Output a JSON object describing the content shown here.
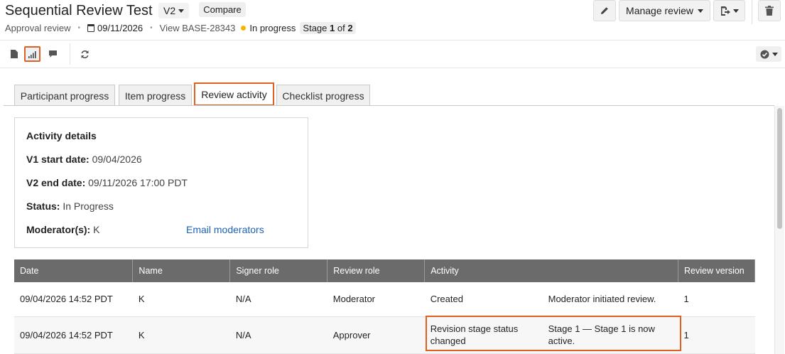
{
  "header": {
    "title": "Sequential Review Test",
    "version": "V2",
    "compare_label": "Compare",
    "review_type": "Approval review",
    "date": "09/11/2026",
    "view_id": "View BASE-28343",
    "status": "In progress",
    "stage_prefix": "Stage",
    "stage_current": "1",
    "stage_of": "of",
    "stage_total": "2",
    "manage_label": "Manage review",
    "status_color": "#f5b400"
  },
  "tabs": [
    "Participant progress",
    "Item progress",
    "Review activity",
    "Checklist progress"
  ],
  "details": {
    "title": "Activity details",
    "v1_label": "V1 start date:",
    "v1_value": "09/04/2026",
    "v2_label": "V2 end date:",
    "v2_value": "09/11/2026 17:00 PDT",
    "status_label": "Status:",
    "status_value": "In Progress",
    "moderators_label": "Moderator(s):",
    "moderators_value": "K",
    "email_label": "Email moderators"
  },
  "table": {
    "columns": [
      "Date",
      "Name",
      "Signer role",
      "Review role",
      "Activity",
      "",
      "Review version"
    ],
    "rows": [
      {
        "date": "09/04/2026 14:52 PDT",
        "name": "K",
        "signer_role": "N/A",
        "review_role": "Moderator",
        "activity": "Created",
        "detail": "Moderator initiated review.",
        "version": "1"
      },
      {
        "date": "09/04/2026 14:52 PDT",
        "name": "K",
        "signer_role": "N/A",
        "review_role": "Approver",
        "activity": "Revision stage status changed",
        "detail": "Stage 1 — Stage 1 is now active.",
        "version": "1"
      }
    ]
  },
  "colors": {
    "highlight": "#e0601f",
    "link": "#1f62b5",
    "table_header": "#6b6b6b"
  }
}
